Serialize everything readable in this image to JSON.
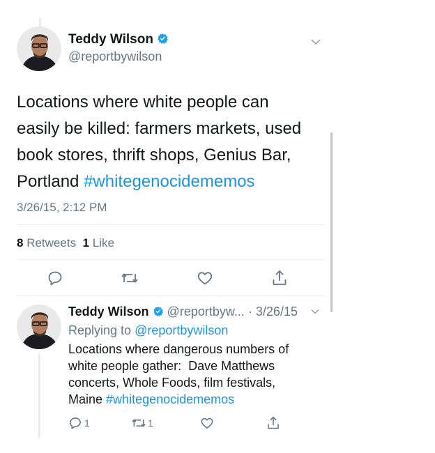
{
  "main_tweet": {
    "author": {
      "name": "Teddy Wilson",
      "handle": "@reportbywilson",
      "verified": true
    },
    "text_plain": "Locations where white people can easily be killed: farmers markets, used book stores, thrift shops, Genius Bar, Portland",
    "text_lines": [
      "Locations where white people can",
      "easily be killed: farmers markets, used",
      "book stores, thrift shops, Genius Bar,",
      "Portland"
    ],
    "hashtag": "#whitegenocidememos",
    "timestamp": "3/26/15, 2:12 PM",
    "stats": {
      "retweets_count": "8",
      "retweets_label": "Retweets",
      "likes_count": "1",
      "likes_label": "Like"
    },
    "actions": [
      "reply-icon",
      "retweet-icon",
      "like-icon",
      "share-icon"
    ]
  },
  "reply_tweet": {
    "author": {
      "name": "Teddy Wilson",
      "handle": "@reportbyw...",
      "separator": "·",
      "date": "3/26/15",
      "verified": true
    },
    "replying_to_label": "Replying to",
    "replying_to_handle": "@reportbywilson",
    "text_lines": [
      "Locations where dangerous numbers of",
      "white people gather:  Dave Matthews",
      "concerts, Whole Foods, film festivals,",
      "Maine"
    ],
    "hashtag": "#whitegenocidememos",
    "actions": {
      "reply_count": "1",
      "retweet_count": "1"
    }
  },
  "colors": {
    "accent": "#1b95e0",
    "text": "#14171a",
    "muted": "#657786",
    "divider": "#e6ecf0",
    "verified": "#1da1f2"
  }
}
